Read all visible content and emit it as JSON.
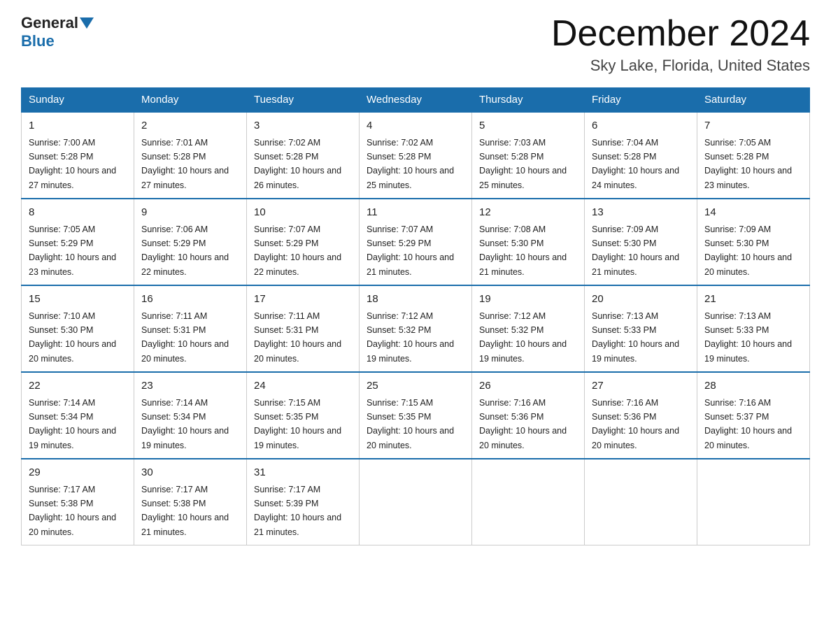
{
  "header": {
    "logo_general": "General",
    "logo_blue": "Blue",
    "month_title": "December 2024",
    "location": "Sky Lake, Florida, United States"
  },
  "days_of_week": [
    "Sunday",
    "Monday",
    "Tuesday",
    "Wednesday",
    "Thursday",
    "Friday",
    "Saturday"
  ],
  "weeks": [
    [
      {
        "day": "1",
        "sunrise": "7:00 AM",
        "sunset": "5:28 PM",
        "daylight": "10 hours and 27 minutes."
      },
      {
        "day": "2",
        "sunrise": "7:01 AM",
        "sunset": "5:28 PM",
        "daylight": "10 hours and 27 minutes."
      },
      {
        "day": "3",
        "sunrise": "7:02 AM",
        "sunset": "5:28 PM",
        "daylight": "10 hours and 26 minutes."
      },
      {
        "day": "4",
        "sunrise": "7:02 AM",
        "sunset": "5:28 PM",
        "daylight": "10 hours and 25 minutes."
      },
      {
        "day": "5",
        "sunrise": "7:03 AM",
        "sunset": "5:28 PM",
        "daylight": "10 hours and 25 minutes."
      },
      {
        "day": "6",
        "sunrise": "7:04 AM",
        "sunset": "5:28 PM",
        "daylight": "10 hours and 24 minutes."
      },
      {
        "day": "7",
        "sunrise": "7:05 AM",
        "sunset": "5:28 PM",
        "daylight": "10 hours and 23 minutes."
      }
    ],
    [
      {
        "day": "8",
        "sunrise": "7:05 AM",
        "sunset": "5:29 PM",
        "daylight": "10 hours and 23 minutes."
      },
      {
        "day": "9",
        "sunrise": "7:06 AM",
        "sunset": "5:29 PM",
        "daylight": "10 hours and 22 minutes."
      },
      {
        "day": "10",
        "sunrise": "7:07 AM",
        "sunset": "5:29 PM",
        "daylight": "10 hours and 22 minutes."
      },
      {
        "day": "11",
        "sunrise": "7:07 AM",
        "sunset": "5:29 PM",
        "daylight": "10 hours and 21 minutes."
      },
      {
        "day": "12",
        "sunrise": "7:08 AM",
        "sunset": "5:30 PM",
        "daylight": "10 hours and 21 minutes."
      },
      {
        "day": "13",
        "sunrise": "7:09 AM",
        "sunset": "5:30 PM",
        "daylight": "10 hours and 21 minutes."
      },
      {
        "day": "14",
        "sunrise": "7:09 AM",
        "sunset": "5:30 PM",
        "daylight": "10 hours and 20 minutes."
      }
    ],
    [
      {
        "day": "15",
        "sunrise": "7:10 AM",
        "sunset": "5:30 PM",
        "daylight": "10 hours and 20 minutes."
      },
      {
        "day": "16",
        "sunrise": "7:11 AM",
        "sunset": "5:31 PM",
        "daylight": "10 hours and 20 minutes."
      },
      {
        "day": "17",
        "sunrise": "7:11 AM",
        "sunset": "5:31 PM",
        "daylight": "10 hours and 20 minutes."
      },
      {
        "day": "18",
        "sunrise": "7:12 AM",
        "sunset": "5:32 PM",
        "daylight": "10 hours and 19 minutes."
      },
      {
        "day": "19",
        "sunrise": "7:12 AM",
        "sunset": "5:32 PM",
        "daylight": "10 hours and 19 minutes."
      },
      {
        "day": "20",
        "sunrise": "7:13 AM",
        "sunset": "5:33 PM",
        "daylight": "10 hours and 19 minutes."
      },
      {
        "day": "21",
        "sunrise": "7:13 AM",
        "sunset": "5:33 PM",
        "daylight": "10 hours and 19 minutes."
      }
    ],
    [
      {
        "day": "22",
        "sunrise": "7:14 AM",
        "sunset": "5:34 PM",
        "daylight": "10 hours and 19 minutes."
      },
      {
        "day": "23",
        "sunrise": "7:14 AM",
        "sunset": "5:34 PM",
        "daylight": "10 hours and 19 minutes."
      },
      {
        "day": "24",
        "sunrise": "7:15 AM",
        "sunset": "5:35 PM",
        "daylight": "10 hours and 19 minutes."
      },
      {
        "day": "25",
        "sunrise": "7:15 AM",
        "sunset": "5:35 PM",
        "daylight": "10 hours and 20 minutes."
      },
      {
        "day": "26",
        "sunrise": "7:16 AM",
        "sunset": "5:36 PM",
        "daylight": "10 hours and 20 minutes."
      },
      {
        "day": "27",
        "sunrise": "7:16 AM",
        "sunset": "5:36 PM",
        "daylight": "10 hours and 20 minutes."
      },
      {
        "day": "28",
        "sunrise": "7:16 AM",
        "sunset": "5:37 PM",
        "daylight": "10 hours and 20 minutes."
      }
    ],
    [
      {
        "day": "29",
        "sunrise": "7:17 AM",
        "sunset": "5:38 PM",
        "daylight": "10 hours and 20 minutes."
      },
      {
        "day": "30",
        "sunrise": "7:17 AM",
        "sunset": "5:38 PM",
        "daylight": "10 hours and 21 minutes."
      },
      {
        "day": "31",
        "sunrise": "7:17 AM",
        "sunset": "5:39 PM",
        "daylight": "10 hours and 21 minutes."
      },
      null,
      null,
      null,
      null
    ]
  ]
}
